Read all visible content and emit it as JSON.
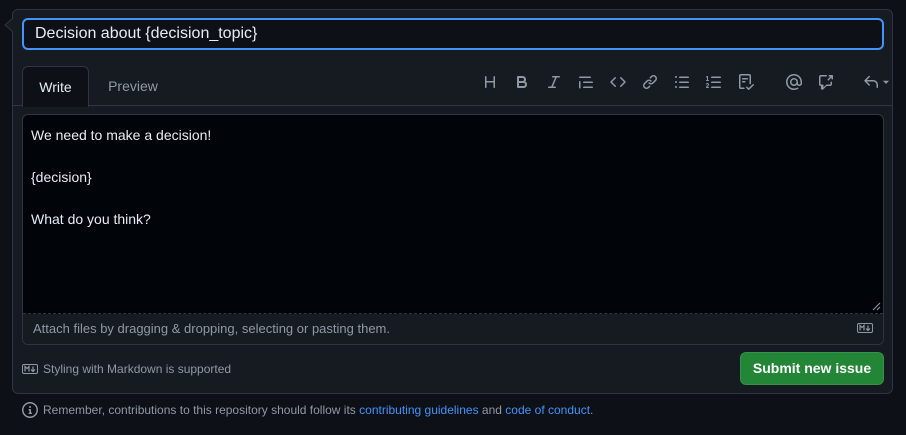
{
  "title_field": {
    "value": "Decision about {decision_topic}"
  },
  "tabs": [
    {
      "label": "Write",
      "active": true
    },
    {
      "label": "Preview",
      "active": false
    }
  ],
  "toolbar": {
    "buttons": [
      "heading-icon",
      "bold-icon",
      "italic-icon",
      "quote-icon",
      "code-icon",
      "link-icon",
      "unordered-list-icon",
      "ordered-list-icon",
      "task-list-icon",
      "mention-icon",
      "cross-reference-icon",
      "undo-icon"
    ]
  },
  "editor": {
    "lines": [
      "We need to make a decision!",
      "",
      "{decision}",
      "",
      "What do you think?"
    ]
  },
  "attach": {
    "text": "Attach files by dragging & dropping, selecting or pasting them."
  },
  "markdown_note": {
    "text": "Styling with Markdown is supported"
  },
  "submit": {
    "label": "Submit new issue"
  },
  "guidelines": {
    "prefix": "Remember, contributions to this repository should follow its",
    "link1": "contributing guidelines",
    "middle": "and",
    "link2": "code of conduct",
    "suffix": "."
  },
  "colors": {
    "accent": "#4493f8",
    "submit_bg": "#238636",
    "background": "#0d1117",
    "panel": "#161b22",
    "muted_text": "#9198a1"
  }
}
